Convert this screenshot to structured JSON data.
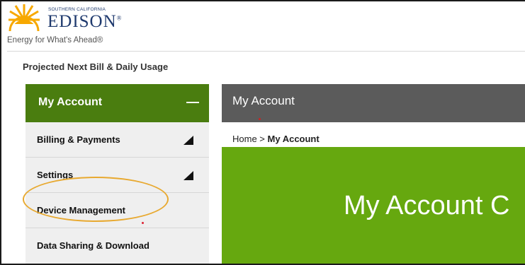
{
  "logo": {
    "small_text": "SOUTHERN CALIFORNIA",
    "brand": "EDISON",
    "registered": "®",
    "tagline": "Energy for What's Ahead®"
  },
  "top_link": "Projected Next Bill & Daily Usage",
  "sidebar": {
    "header": "My Account",
    "collapse_icon": "minus-icon",
    "items": [
      {
        "label": "Billing & Payments",
        "expandable": true
      },
      {
        "label": "Settings",
        "expandable": true
      },
      {
        "label": "Device Management",
        "expandable": false
      },
      {
        "label": "Data Sharing & Download",
        "expandable": false
      }
    ]
  },
  "main": {
    "title_bar": "My Account",
    "breadcrumb": {
      "home": "Home",
      "separator": " > ",
      "current": "My Account"
    },
    "hero_title": "My Account C"
  },
  "colors": {
    "sidebar_header": "#4a7d0f",
    "hero": "#66a80f",
    "title_bar": "#5b5b5b",
    "highlight": "#e8a930"
  }
}
